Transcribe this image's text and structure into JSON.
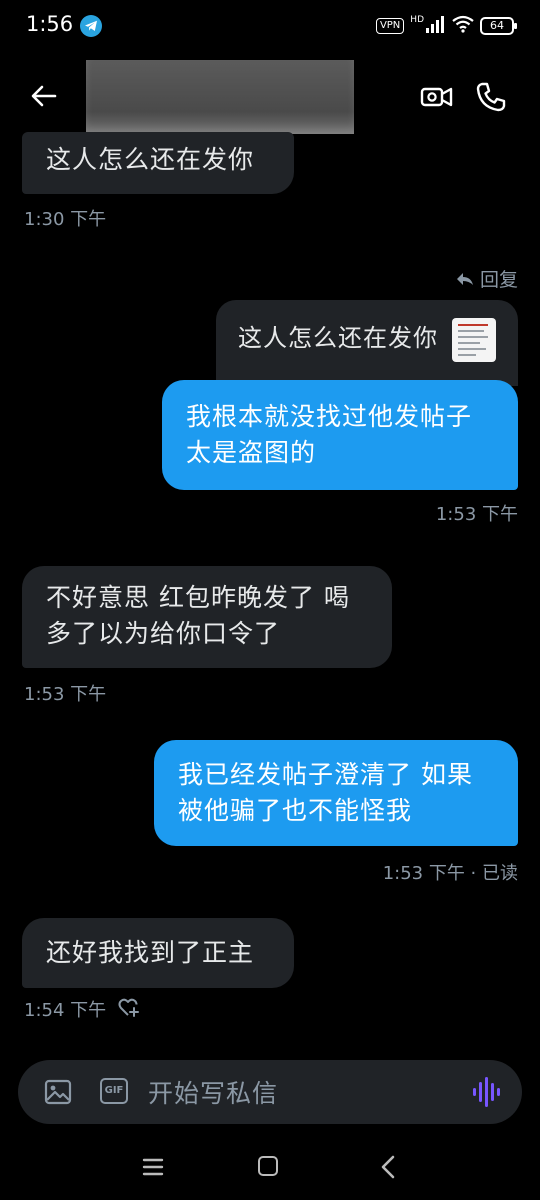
{
  "status_bar": {
    "time": "1:56",
    "vpn": "VPN",
    "hd": "HD",
    "battery": "64"
  },
  "header": {
    "contact_name": "",
    "accent_color": "#1d9bf0"
  },
  "messages": [
    {
      "direction": "in",
      "text": "这人怎么还在发你",
      "meta": "1:30 下午"
    },
    {
      "direction": "out",
      "reply_label": "回复",
      "quoted_text": "这人怎么还在发你",
      "text": "我根本就没找过他发帖子\n太是盗图的",
      "meta": "1:53 下午"
    },
    {
      "direction": "in",
      "text": "不好意思 红包昨晚发了 喝\n多了以为给你口令了",
      "meta": "1:53 下午"
    },
    {
      "direction": "out",
      "text": "我已经发帖子澄清了 如果\n被他骗了也不能怪我",
      "meta": "1:53 下午 · 已读"
    },
    {
      "direction": "in",
      "text": "还好我找到了正主",
      "meta": "1:54 下午",
      "reaction_icon": "heart-plus-icon"
    }
  ],
  "composer": {
    "gif_label": "GIF",
    "placeholder": "开始写私信"
  },
  "colors": {
    "incoming_bubble": "#202327",
    "outgoing_bubble": "#1d9bf0",
    "meta_text": "#8b98a5",
    "voice_icon": "#7856ff"
  }
}
